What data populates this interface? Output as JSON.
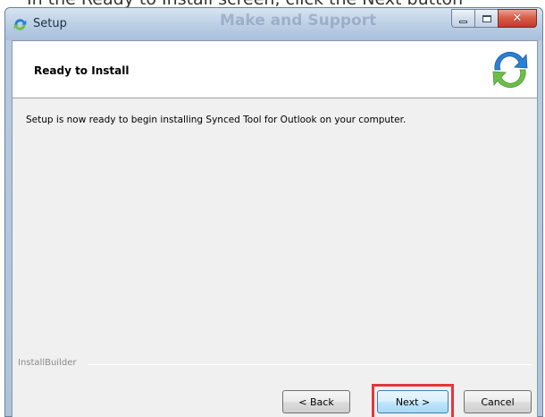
{
  "caption": "In the Ready to Install screen, click the Next button",
  "window": {
    "title": "Setup",
    "background_text": "Make and Support"
  },
  "header": {
    "title": "Ready to Install"
  },
  "body": {
    "message": "Setup is now ready to begin installing Synced Tool for Outlook on your computer."
  },
  "footer": {
    "builder_label": "InstallBuilder"
  },
  "buttons": {
    "back_label": "< Back",
    "next_label": "Next >",
    "cancel_label": "Cancel"
  },
  "icons": {
    "app": "sync-icon",
    "logo": "sync-logo-icon",
    "minimize": "minimize-icon",
    "maximize": "maximize-icon",
    "close": "close-icon"
  },
  "colors": {
    "highlight": "#e0383b",
    "logo_blue": "#2a7fd4",
    "logo_green": "#6cc04a"
  }
}
